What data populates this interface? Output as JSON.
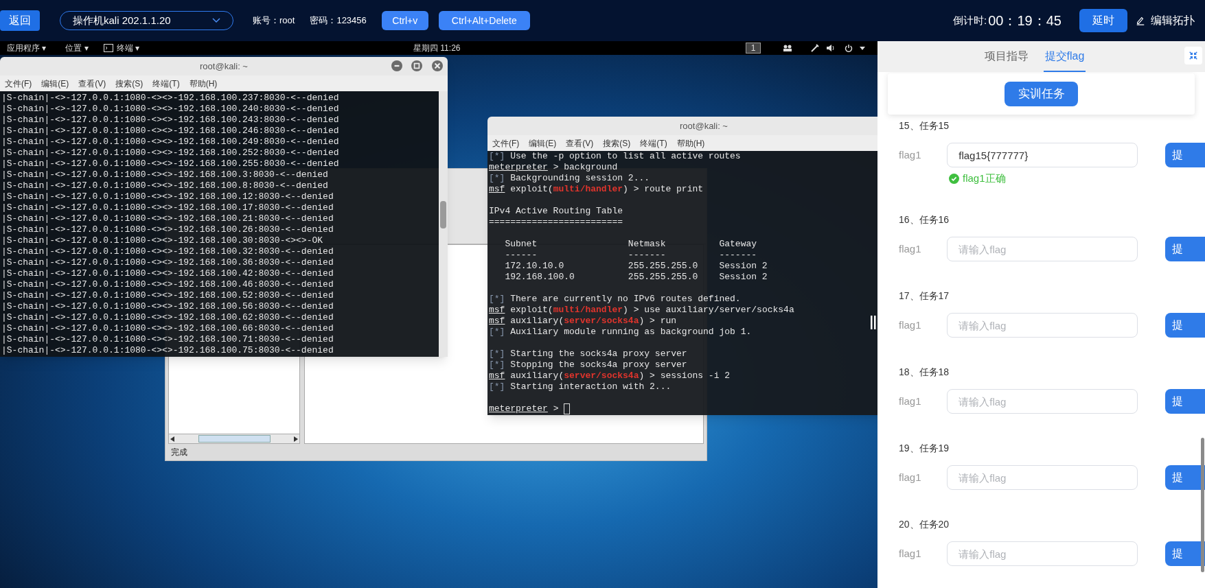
{
  "top_bar": {
    "back_button": "返回",
    "machine_select": "操作机kali 202.1.1.20",
    "account": "账号：root",
    "password": "密码：123456",
    "key_buttons": [
      "Ctrl+v",
      "Ctrl+Alt+Delete"
    ],
    "countdown_label": "倒计时:",
    "countdown_time": "00：19：45",
    "delay_button": "延时",
    "edit_topology": "编辑拓扑"
  },
  "desktop": {
    "panel": {
      "menus": [
        "应用程序 ▾",
        "位置 ▾",
        "终端 ▾"
      ],
      "clock": "星期四 11:26",
      "workspace": "1"
    },
    "left_terminal": {
      "title": "root@kali: ~",
      "menu": [
        "文件(F)",
        "编辑(E)",
        "查看(V)",
        "搜索(S)",
        "终端(T)",
        "帮助(H)"
      ],
      "lines": [
        "|S-chain|-<>-127.0.0.1:1080-<><>-192.168.100.237:8030-<--denied",
        "|S-chain|-<>-127.0.0.1:1080-<><>-192.168.100.240:8030-<--denied",
        "|S-chain|-<>-127.0.0.1:1080-<><>-192.168.100.243:8030-<--denied",
        "|S-chain|-<>-127.0.0.1:1080-<><>-192.168.100.246:8030-<--denied",
        "|S-chain|-<>-127.0.0.1:1080-<><>-192.168.100.249:8030-<--denied",
        "|S-chain|-<>-127.0.0.1:1080-<><>-192.168.100.252:8030-<--denied",
        "|S-chain|-<>-127.0.0.1:1080-<><>-192.168.100.255:8030-<--denied",
        "|S-chain|-<>-127.0.0.1:1080-<><>-192.168.100.3:8030-<--denied",
        "|S-chain|-<>-127.0.0.1:1080-<><>-192.168.100.8:8030-<--denied",
        "|S-chain|-<>-127.0.0.1:1080-<><>-192.168.100.12:8030-<--denied",
        "|S-chain|-<>-127.0.0.1:1080-<><>-192.168.100.17:8030-<--denied",
        "|S-chain|-<>-127.0.0.1:1080-<><>-192.168.100.21:8030-<--denied",
        "|S-chain|-<>-127.0.0.1:1080-<><>-192.168.100.26:8030-<--denied",
        "|S-chain|-<>-127.0.0.1:1080-<><>-192.168.100.30:8030-<><>-OK",
        "|S-chain|-<>-127.0.0.1:1080-<><>-192.168.100.32:8030-<--denied",
        "|S-chain|-<>-127.0.0.1:1080-<><>-192.168.100.36:8030-<--denied",
        "|S-chain|-<>-127.0.0.1:1080-<><>-192.168.100.42:8030-<--denied",
        "|S-chain|-<>-127.0.0.1:1080-<><>-192.168.100.46:8030-<--denied",
        "|S-chain|-<>-127.0.0.1:1080-<><>-192.168.100.52:8030-<--denied",
        "|S-chain|-<>-127.0.0.1:1080-<><>-192.168.100.56:8030-<--denied",
        "|S-chain|-<>-127.0.0.1:1080-<><>-192.168.100.62:8030-<--denied",
        "|S-chain|-<>-127.0.0.1:1080-<><>-192.168.100.66:8030-<--denied",
        "|S-chain|-<>-127.0.0.1:1080-<><>-192.168.100.71:8030-<--denied",
        "|S-chain|-<>-127.0.0.1:1080-<><>-192.168.100.75:8030-<--denied"
      ]
    },
    "file_window": {
      "status": "完成"
    },
    "right_terminal": {
      "title": "root@kali: ~",
      "menu": [
        "文件(F)",
        "编辑(E)",
        "查看(V)",
        "搜索(S)",
        "终端(T)",
        "帮助(H)"
      ],
      "blocks": [
        [
          [
            {
              "kind": "dim",
              "text": "[*]"
            },
            {
              "kind": "plain",
              "text": " Use the -p option to list all active routes"
            }
          ],
          [
            {
              "kind": "prompt",
              "text": "meterpreter"
            },
            {
              "kind": "plain",
              "text": " > background"
            }
          ],
          [
            {
              "kind": "dim",
              "text": "[*]"
            },
            {
              "kind": "plain",
              "text": " Backgrounding session 2..."
            }
          ],
          [
            {
              "kind": "prompt",
              "text": "msf"
            },
            {
              "kind": "plain",
              "text": " exploit("
            },
            {
              "kind": "red",
              "text": "multi/handler"
            },
            {
              "kind": "plain",
              "text": ") > route print"
            }
          ]
        ],
        [
          [
            {
              "kind": "plain",
              "text": "IPv4 Active Routing Table"
            }
          ],
          [
            {
              "kind": "plain",
              "text": "========================="
            }
          ]
        ],
        [
          [
            {
              "kind": "plain",
              "text": "   Subnet                 Netmask          Gateway"
            }
          ],
          [
            {
              "kind": "plain",
              "text": "   ------                 -------          -------"
            }
          ],
          [
            {
              "kind": "plain",
              "text": "   172.10.10.0            255.255.255.0    Session 2"
            }
          ],
          [
            {
              "kind": "plain",
              "text": "   192.168.100.0          255.255.255.0    Session 2"
            }
          ]
        ],
        [
          [
            {
              "kind": "dim",
              "text": "[*]"
            },
            {
              "kind": "plain",
              "text": " There are currently no IPv6 routes defined."
            }
          ],
          [
            {
              "kind": "prompt",
              "text": "msf"
            },
            {
              "kind": "plain",
              "text": " exploit("
            },
            {
              "kind": "red",
              "text": "multi/handler"
            },
            {
              "kind": "plain",
              "text": ") > use auxiliary/server/socks4a"
            }
          ],
          [
            {
              "kind": "prompt",
              "text": "msf"
            },
            {
              "kind": "plain",
              "text": " auxiliary("
            },
            {
              "kind": "red",
              "text": "server/socks4a"
            },
            {
              "kind": "plain",
              "text": ") > run"
            }
          ],
          [
            {
              "kind": "dim",
              "text": "[*]"
            },
            {
              "kind": "plain",
              "text": " Auxiliary module running as background job 1."
            }
          ]
        ],
        [
          [
            {
              "kind": "dim",
              "text": "[*]"
            },
            {
              "kind": "plain",
              "text": " Starting the socks4a proxy server"
            }
          ],
          [
            {
              "kind": "dim",
              "text": "[*]"
            },
            {
              "kind": "plain",
              "text": " Stopping the socks4a proxy server"
            }
          ],
          [
            {
              "kind": "prompt",
              "text": "msf"
            },
            {
              "kind": "plain",
              "text": " auxiliary("
            },
            {
              "kind": "red",
              "text": "server/socks4a"
            },
            {
              "kind": "plain",
              "text": ") > sessions -i 2"
            }
          ],
          [
            {
              "kind": "dim",
              "text": "[*]"
            },
            {
              "kind": "plain",
              "text": " Starting interaction with 2..."
            }
          ]
        ],
        [
          [
            {
              "kind": "prompt",
              "text": "meterpreter"
            },
            {
              "kind": "plain",
              "text": " > "
            }
          ]
        ]
      ]
    }
  },
  "side_panel": {
    "tabs": [
      {
        "label": "项目指导",
        "selected": false
      },
      {
        "label": "提交flag",
        "selected": true
      }
    ],
    "task_button": "实训任务",
    "tasks": [
      {
        "title": "15、任务15",
        "label": "flag1",
        "value": "flag15{777777}",
        "submit": "提",
        "result": {
          "kind": "success",
          "text": "flag1正确"
        }
      },
      {
        "title": "16、任务16",
        "label": "flag1",
        "placeholder": "请输入flag",
        "submit": "提"
      },
      {
        "title": "17、任务17",
        "label": "flag1",
        "placeholder": "请输入flag",
        "submit": "提"
      },
      {
        "title": "18、任务18",
        "label": "flag1",
        "placeholder": "请输入flag",
        "submit": "提"
      },
      {
        "title": "19、任务19",
        "label": "flag1",
        "placeholder": "请输入flag",
        "submit": "提"
      },
      {
        "title": "20、任务20",
        "label": "flag1",
        "placeholder": "请输入flag",
        "submit": "提"
      }
    ]
  }
}
